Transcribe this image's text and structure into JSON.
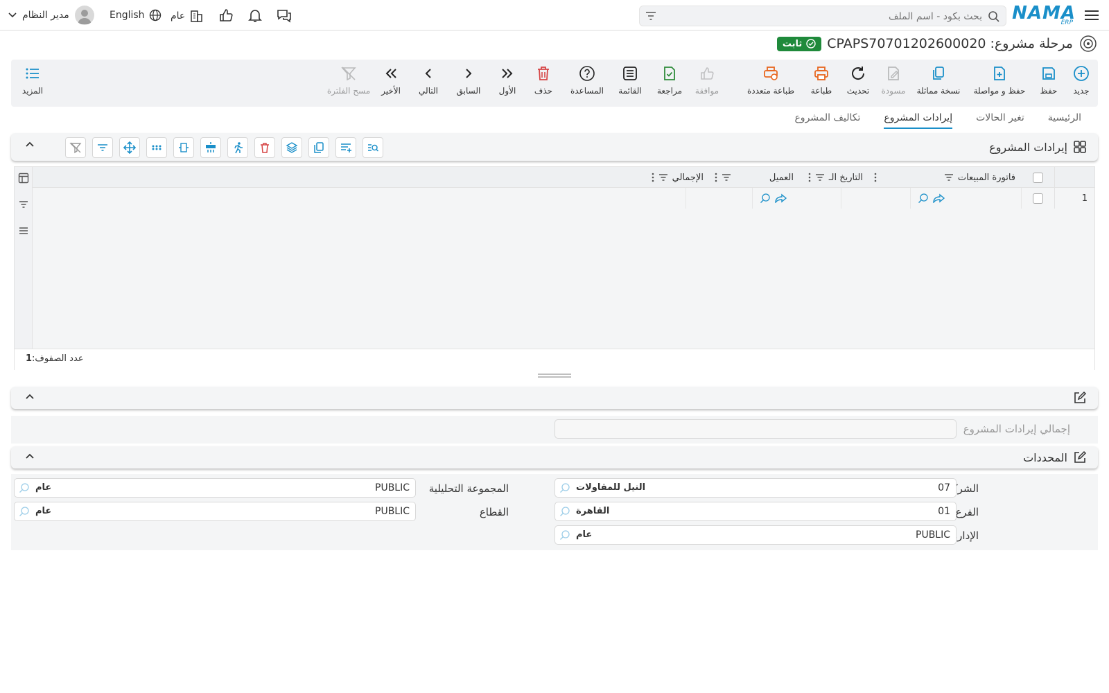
{
  "header": {
    "logo_text": "NAMA",
    "logo_sub": "ERP",
    "search_placeholder": "بحث بكود - اسم الملف",
    "language": "English",
    "company": "عام",
    "user": "مدير النظام"
  },
  "title": {
    "text": "مرحلة مشروع: CPAPS70701202600020",
    "status": "ثابت"
  },
  "toolbar": {
    "new": "جديد",
    "save": "حفظ",
    "save_continue": "حفظ و مواصلة",
    "duplicate": "نسخة مماثلة",
    "draft": "مسودة",
    "refresh": "تحديث",
    "print": "طباعة",
    "multi_print": "طباعة متعددة",
    "approve": "موافقة",
    "review": "مراجعة",
    "list": "القائمة",
    "help": "المساعدة",
    "delete": "حذف",
    "first": "الأول",
    "previous": "السابق",
    "next": "التالي",
    "last": "الأخير",
    "clear_filter": "مسح الفلترة",
    "more": "المزيد"
  },
  "tabs": [
    "الرئيسية",
    "تغير الحالات",
    "إيرادات المشروع",
    "تكاليف المشروع"
  ],
  "revenue_section": {
    "title": "إيرادات المشروع",
    "columns": [
      "فاتورة المبيعات",
      "التاريخ الـ",
      "العميل",
      "الإجمالي"
    ],
    "row_number": "1",
    "row_count_label": "عدد الصفوف:",
    "row_count": "1"
  },
  "totals": {
    "label": "إجمالي إيرادات المشروع",
    "value": ""
  },
  "dimensions": {
    "title": "المحددات",
    "company": {
      "label": "الشركة",
      "code": "07",
      "name": "النيل للمقاولات"
    },
    "branch": {
      "label": "الفرع",
      "code": "01",
      "name": "القاهرة"
    },
    "department": {
      "label": "الإدارة",
      "code": "PUBLIC",
      "name": "عام"
    },
    "analysis_set": {
      "label": "المجموعة التحليلية",
      "code": "PUBLIC",
      "name": "عام"
    },
    "sector": {
      "label": "القطاع",
      "code": "PUBLIC",
      "name": "عام"
    }
  },
  "colors": {
    "accent": "#1a8fc9",
    "status_green": "#1f8a3b",
    "delete_red": "#d64545",
    "print_orange": "#e8661e"
  }
}
